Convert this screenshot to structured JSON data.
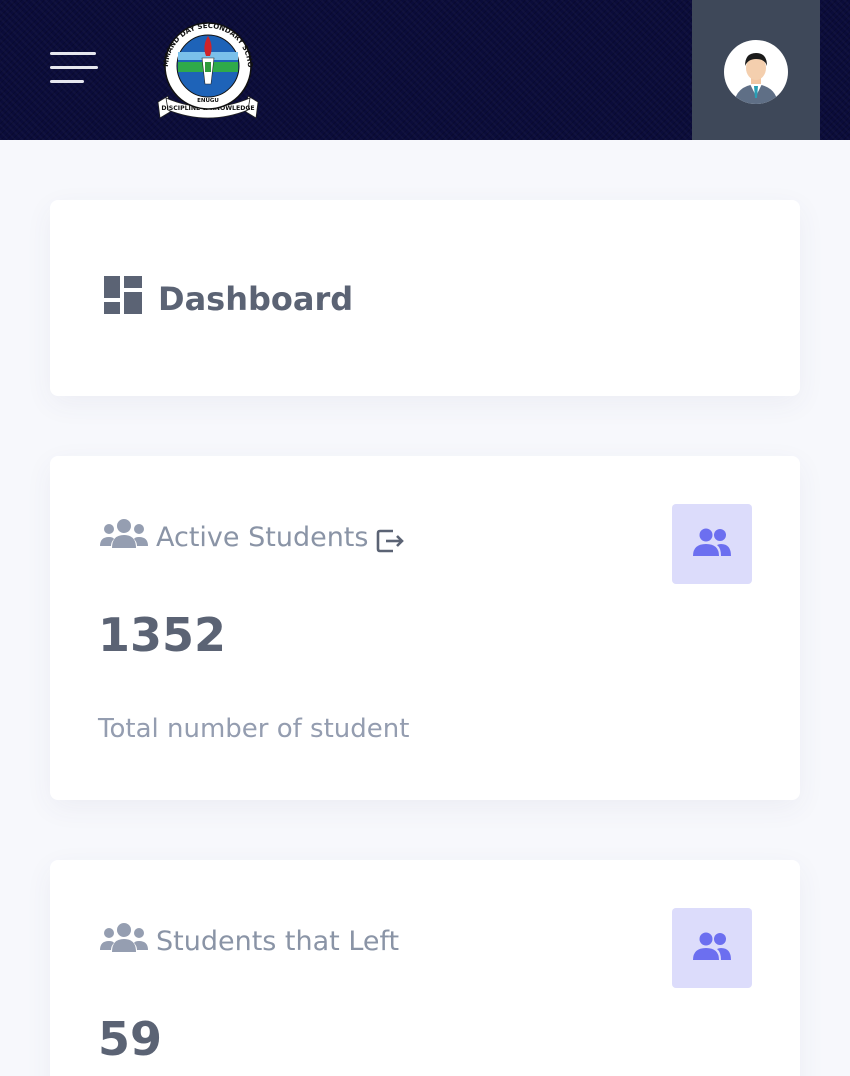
{
  "header": {
    "logo": {
      "school_name": "COMMAND DAY SECONDARY SCHOOL",
      "location": "ENUGU",
      "motto": "DISCIPLINE & KNOWLEDGE"
    },
    "colors": {
      "bar": "#0b0c3a",
      "avatar_box": "#3e4859"
    },
    "icons": {
      "menu": "hamburger-icon",
      "profile": "user-avatar"
    }
  },
  "page": {
    "title": "Dashboard",
    "title_icon": "dashboard-grid-icon"
  },
  "stats": [
    {
      "label": "Active Students",
      "value": "1352",
      "note": "Total number of student",
      "icons": [
        "users-icon",
        "logout-icon",
        "group-icon"
      ]
    },
    {
      "label": "Students that Left",
      "value": "59",
      "icons": [
        "users-icon",
        "group-icon"
      ]
    }
  ],
  "colors": {
    "accent": "#6c6ff0",
    "badge_bg": "#dcdcfb",
    "text_dark": "#5b6374",
    "text_muted": "#8a94a6",
    "background": "#f7f8fc"
  }
}
